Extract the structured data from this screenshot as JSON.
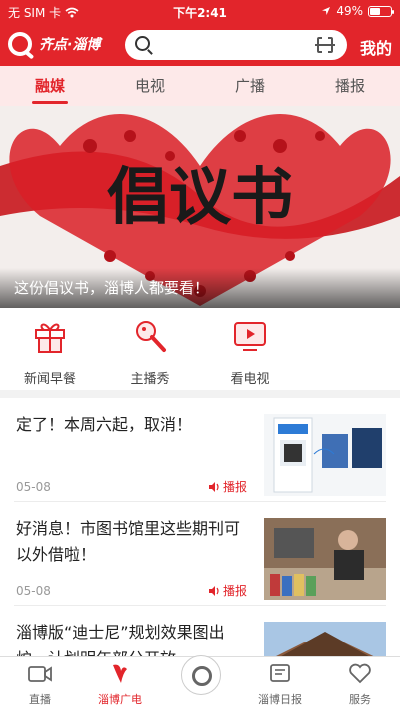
{
  "status_bar": {
    "carrier": "无 SIM 卡",
    "time": "下午2:41",
    "battery_text": "49%",
    "battery_level": 0.49
  },
  "header": {
    "logo_text": "齐点·淄博",
    "mine_label": "我的",
    "search_placeholder": ""
  },
  "tabs": [
    {
      "label": "融媒",
      "active": true
    },
    {
      "label": "电视",
      "active": false
    },
    {
      "label": "广播",
      "active": false
    },
    {
      "label": "播报",
      "active": false
    }
  ],
  "banner": {
    "headline_art": "倡议书",
    "caption": "这份倡议书，淄博人都要看！"
  },
  "quick_links": [
    {
      "label": "新闻早餐",
      "icon": "gift-icon"
    },
    {
      "label": "主播秀",
      "icon": "microphone-icon"
    },
    {
      "label": "看电视",
      "icon": "tv-play-icon"
    }
  ],
  "news": [
    {
      "title": "定了！本周六起，取消！",
      "date": "05-08",
      "tag": "播报"
    },
    {
      "title": "好消息！市图书馆里这些期刊可以外借啦！",
      "date": "05-08",
      "tag": "播报"
    },
    {
      "title": "淄博版“迪士尼”规划效果图出炉，计划明年部分开放",
      "date": "",
      "tag": ""
    }
  ],
  "bottom_nav": [
    {
      "label": "直播",
      "icon": "video-icon",
      "active": false
    },
    {
      "label": "淄博广电",
      "icon": "zibo-logo-icon",
      "active": true
    },
    {
      "label": "",
      "icon": "qidian-logo-icon",
      "active": false
    },
    {
      "label": "淄博日报",
      "icon": "newspaper-icon",
      "active": false
    },
    {
      "label": "服务",
      "icon": "heart-icon",
      "active": false
    }
  ],
  "colors": {
    "brand_red": "#e2252b",
    "tab_bg": "#fde9e9"
  }
}
